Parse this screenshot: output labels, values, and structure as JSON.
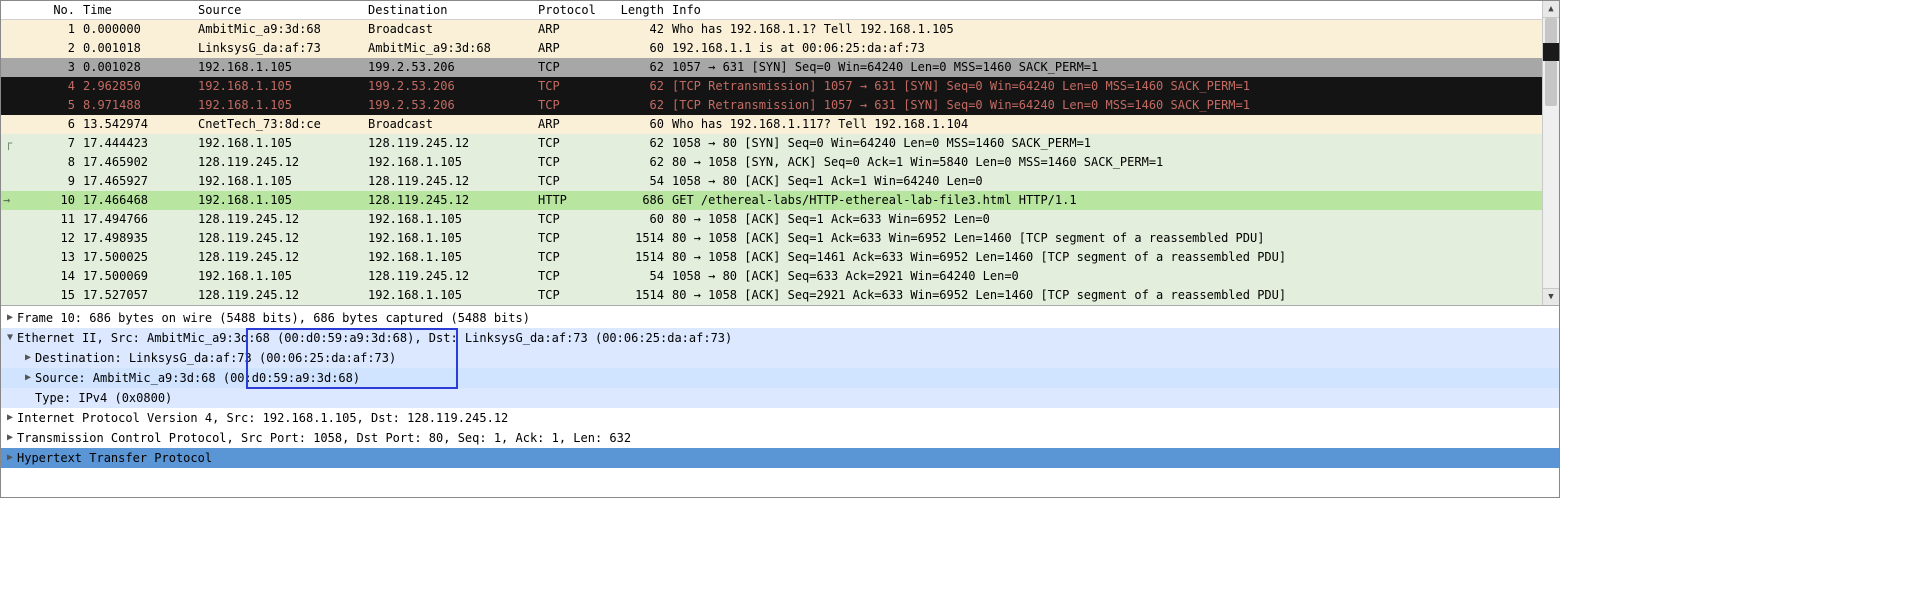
{
  "columns": {
    "no": "No.",
    "time": "Time",
    "src": "Source",
    "dst": "Destination",
    "proto": "Protocol",
    "len": "Length",
    "info": "Info"
  },
  "packets": [
    {
      "no": "1",
      "time": "0.000000",
      "src": "AmbitMic_a9:3d:68",
      "dst": "Broadcast",
      "proto": "ARP",
      "len": "42",
      "info": "Who has 192.168.1.1? Tell 192.168.1.105",
      "cls": "arp"
    },
    {
      "no": "2",
      "time": "0.001018",
      "src": "LinksysG_da:af:73",
      "dst": "AmbitMic_a9:3d:68",
      "proto": "ARP",
      "len": "60",
      "info": "192.168.1.1 is at 00:06:25:da:af:73",
      "cls": "arp"
    },
    {
      "no": "3",
      "time": "0.001028",
      "src": "192.168.1.105",
      "dst": "199.2.53.206",
      "proto": "TCP",
      "len": "62",
      "info": "1057 → 631 [SYN] Seq=0 Win=64240 Len=0 MSS=1460 SACK_PERM=1",
      "cls": "selected"
    },
    {
      "no": "4",
      "time": "2.962850",
      "src": "192.168.1.105",
      "dst": "199.2.53.206",
      "proto": "TCP",
      "len": "62",
      "info": "[TCP Retransmission] 1057 → 631 [SYN] Seq=0 Win=64240 Len=0 MSS=1460 SACK_PERM=1",
      "cls": "retrans"
    },
    {
      "no": "5",
      "time": "8.971488",
      "src": "192.168.1.105",
      "dst": "199.2.53.206",
      "proto": "TCP",
      "len": "62",
      "info": "[TCP Retransmission] 1057 → 631 [SYN] Seq=0 Win=64240 Len=0 MSS=1460 SACK_PERM=1",
      "cls": "retrans"
    },
    {
      "no": "6",
      "time": "13.542974",
      "src": "CnetTech_73:8d:ce",
      "dst": "Broadcast",
      "proto": "ARP",
      "len": "60",
      "info": "Who has 192.168.1.117? Tell 192.168.1.104",
      "cls": "arp"
    },
    {
      "no": "7",
      "time": "17.444423",
      "src": "192.168.1.105",
      "dst": "128.119.245.12",
      "proto": "TCP",
      "len": "62",
      "info": "1058 → 80 [SYN] Seq=0 Win=64240 Len=0 MSS=1460 SACK_PERM=1",
      "cls": "tcp"
    },
    {
      "no": "8",
      "time": "17.465902",
      "src": "128.119.245.12",
      "dst": "192.168.1.105",
      "proto": "TCP",
      "len": "62",
      "info": "80 → 1058 [SYN, ACK] Seq=0 Ack=1 Win=5840 Len=0 MSS=1460 SACK_PERM=1",
      "cls": "tcp"
    },
    {
      "no": "9",
      "time": "17.465927",
      "src": "192.168.1.105",
      "dst": "128.119.245.12",
      "proto": "TCP",
      "len": "54",
      "info": "1058 → 80 [ACK] Seq=1 Ack=1 Win=64240 Len=0",
      "cls": "tcp"
    },
    {
      "no": "10",
      "time": "17.466468",
      "src": "192.168.1.105",
      "dst": "128.119.245.12",
      "proto": "HTTP",
      "len": "686",
      "info": "GET /ethereal-labs/HTTP-ethereal-lab-file3.html HTTP/1.1",
      "cls": "httpsel"
    },
    {
      "no": "11",
      "time": "17.494766",
      "src": "128.119.245.12",
      "dst": "192.168.1.105",
      "proto": "TCP",
      "len": "60",
      "info": "80 → 1058 [ACK] Seq=1 Ack=633 Win=6952 Len=0",
      "cls": "tcp"
    },
    {
      "no": "12",
      "time": "17.498935",
      "src": "128.119.245.12",
      "dst": "192.168.1.105",
      "proto": "TCP",
      "len": "1514",
      "info": "80 → 1058 [ACK] Seq=1 Ack=633 Win=6952 Len=1460 [TCP segment of a reassembled PDU]",
      "cls": "tcp"
    },
    {
      "no": "13",
      "time": "17.500025",
      "src": "128.119.245.12",
      "dst": "192.168.1.105",
      "proto": "TCP",
      "len": "1514",
      "info": "80 → 1058 [ACK] Seq=1461 Ack=633 Win=6952 Len=1460 [TCP segment of a reassembled PDU]",
      "cls": "tcp"
    },
    {
      "no": "14",
      "time": "17.500069",
      "src": "192.168.1.105",
      "dst": "128.119.245.12",
      "proto": "TCP",
      "len": "54",
      "info": "1058 → 80 [ACK] Seq=633 Ack=2921 Win=64240 Len=0",
      "cls": "tcp"
    },
    {
      "no": "15",
      "time": "17.527057",
      "src": "128.119.245.12",
      "dst": "192.168.1.105",
      "proto": "TCP",
      "len": "1514",
      "info": "80 → 1058 [ACK] Seq=2921 Ack=633 Win=6952 Len=1460 [TCP segment of a reassembled PDU]",
      "cls": "tcp"
    }
  ],
  "details": {
    "frame": "Frame 10: 686 bytes on wire (5488 bits), 686 bytes captured (5488 bits)",
    "ethernet": "Ethernet II, Src: AmbitMic_a9:3d:68 (00:d0:59:a9:3d:68), Dst: LinksysG_da:af:73 (00:06:25:da:af:73)",
    "eth_dst": "Destination: LinksysG_da:af:73 (00:06:25:da:af:73)",
    "eth_src": "Source: AmbitMic_a9:3d:68 (00:d0:59:a9:3d:68)",
    "eth_type": "Type: IPv4 (0x0800)",
    "ip": "Internet Protocol Version 4, Src: 192.168.1.105, Dst: 128.119.245.12",
    "tcp": "Transmission Control Protocol, Src Port: 1058, Dst Port: 80, Seq: 1, Ack: 1, Len: 632",
    "http": "Hypertext Transfer Protocol"
  }
}
